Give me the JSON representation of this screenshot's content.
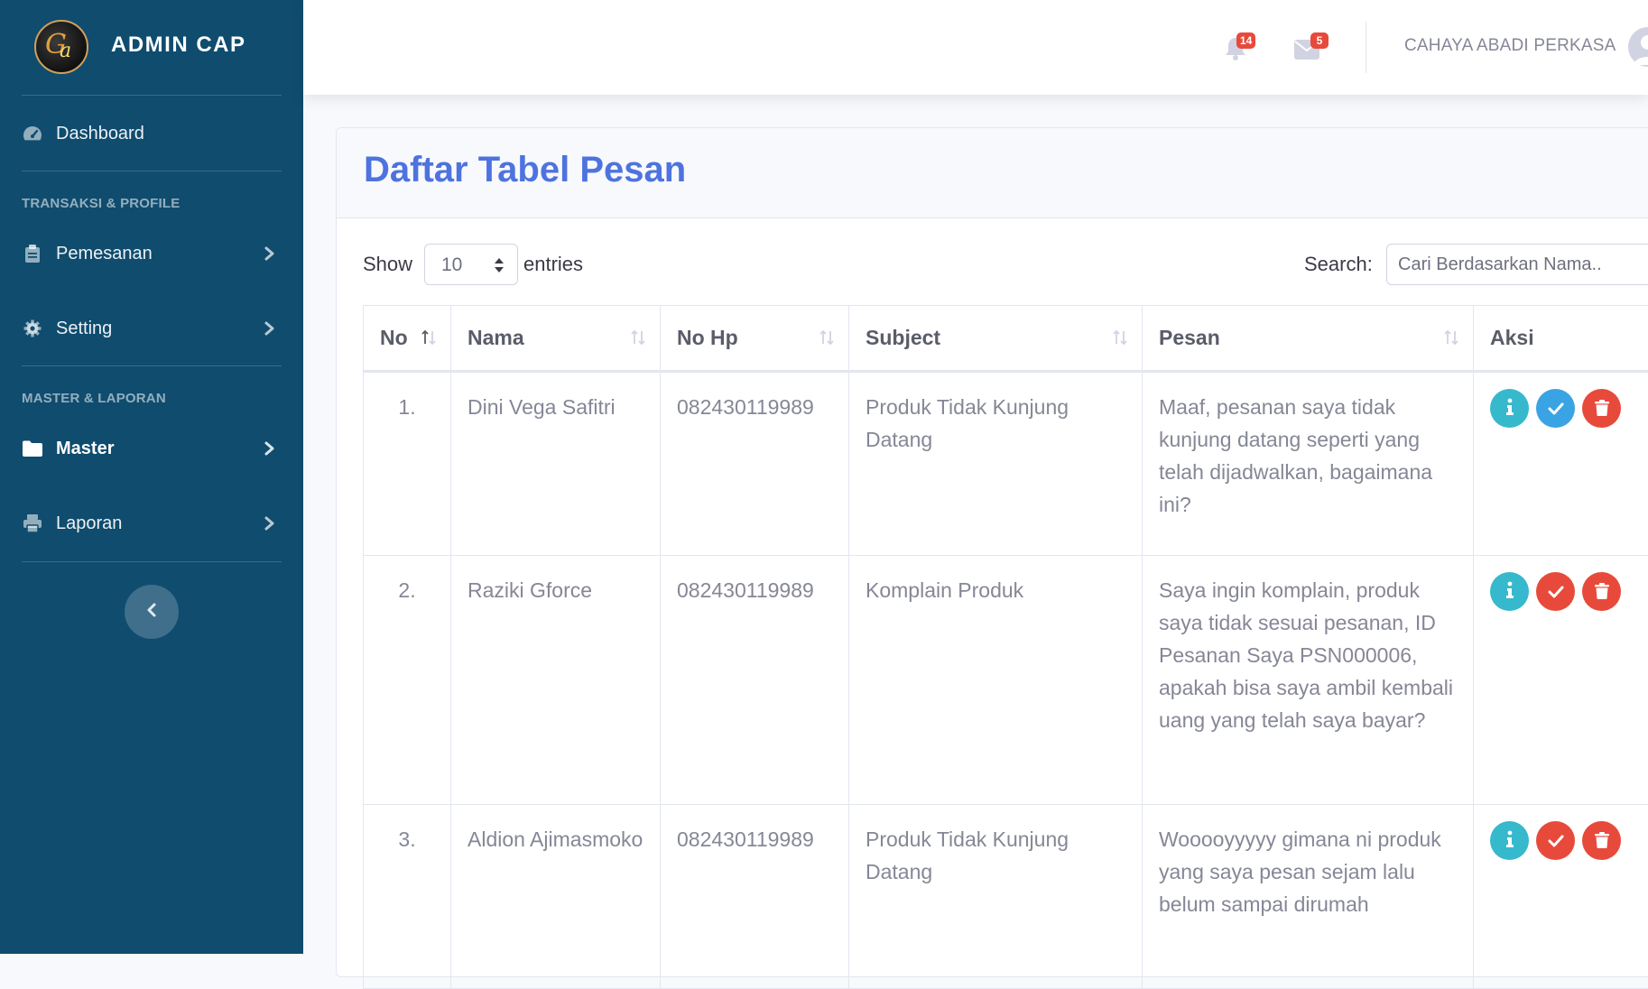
{
  "brand": {
    "title": "ADMIN CAP"
  },
  "sidebar": {
    "dashboard": "Dashboard",
    "section1": "TRANSAKSI & PROFILE",
    "pemesanan": "Pemesanan",
    "setting": "Setting",
    "section2": "MASTER & LAPORAN",
    "master": "Master",
    "laporan": "Laporan"
  },
  "topbar": {
    "alerts_count": "14",
    "messages_count": "5",
    "user_name": "CAHAYA ABADI PERKASA"
  },
  "page": {
    "title": "Daftar Tabel Pesan"
  },
  "table_controls": {
    "show_label": "Show",
    "entries_value": "10",
    "entries_label": "entries",
    "search_label": "Search:",
    "search_placeholder": "Cari Berdasarkan Nama.."
  },
  "table": {
    "headers": [
      "No",
      "Nama",
      "No Hp",
      "Subject",
      "Pesan",
      "Aksi"
    ],
    "rows": [
      {
        "no": "1.",
        "nama": "Dini Vega Safitri",
        "hp": "082430119989",
        "subject": "Produk Tidak Kunjung Datang",
        "pesan": "Maaf, pesanan saya tidak kunjung datang seperti yang telah dijadwalkan, bagaimana ini?",
        "status_color": "#3aa3e3"
      },
      {
        "no": "2.",
        "nama": "Raziki Gforce",
        "hp": "082430119989",
        "subject": "Komplain Produk",
        "pesan": "Saya ingin komplain, produk saya tidak sesuai pesanan, ID Pesanan Saya PSN000006, apakah bisa saya ambil kembali uang yang telah saya bayar?",
        "status_color": "#e74a3b"
      },
      {
        "no": "3.",
        "nama": "Aldion Ajimasmoko",
        "hp": "082430119989",
        "subject": "Produk Tidak Kunjung Datang",
        "pesan": "Wooooyyyyy gimana ni produk yang saya pesan sejam lalu belum sampai dirumah",
        "status_color": "#e74a3b"
      }
    ]
  },
  "colors": {
    "sidebar_bg": "#0f4c6e",
    "primary": "#4e73df",
    "info": "#36b9cc",
    "danger": "#e74a3b"
  }
}
